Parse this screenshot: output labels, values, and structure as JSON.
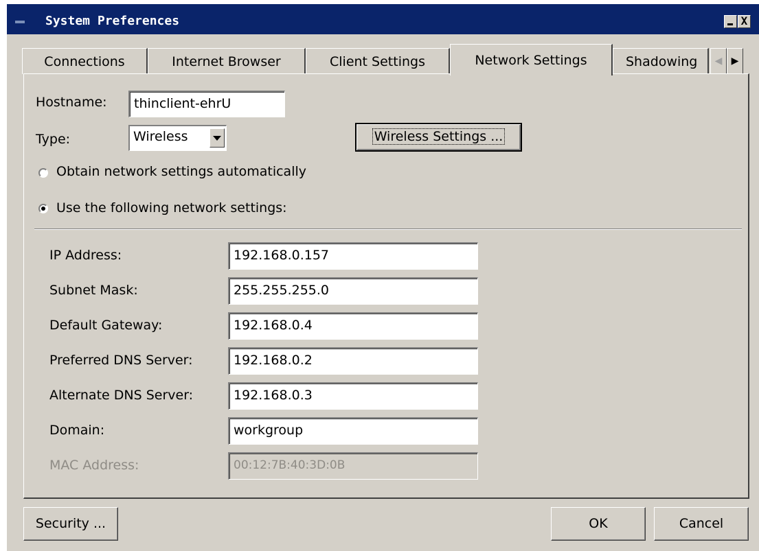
{
  "window": {
    "title": "System Preferences",
    "minimize_icon": "minimize-icon",
    "close_label": "X"
  },
  "tabs": [
    {
      "label": "Connections",
      "active": false
    },
    {
      "label": "Internet Browser",
      "active": false
    },
    {
      "label": "Client Settings",
      "active": false
    },
    {
      "label": "Network Settings",
      "active": true
    },
    {
      "label": "Shadowing",
      "active": false
    }
  ],
  "tab_scroll": {
    "left_icon": "chevron-left-icon",
    "right_icon": "chevron-right-icon"
  },
  "network": {
    "hostname_label": "Hostname:",
    "hostname_value": "thinclient-ehrU",
    "type_label": "Type:",
    "type_value": "Wireless",
    "wireless_button": "Wireless Settings ...",
    "auto_radio_label": "Obtain network settings automatically",
    "manual_radio_label": "Use the following network settings:",
    "selected_mode": "manual",
    "fields": [
      {
        "label": "IP Address:",
        "value": "192.168.0.157",
        "enabled": true
      },
      {
        "label": "Subnet Mask:",
        "value": "255.255.255.0",
        "enabled": true
      },
      {
        "label": "Default Gateway:",
        "value": "192.168.0.4",
        "enabled": true
      },
      {
        "label": "Preferred DNS Server:",
        "value": "192.168.0.2",
        "enabled": true
      },
      {
        "label": "Alternate DNS Server:",
        "value": "192.168.0.3",
        "enabled": true
      },
      {
        "label": "Domain:",
        "value": "workgroup",
        "enabled": true
      },
      {
        "label": "MAC Address:",
        "value": "00:12:7B:40:3D:0B",
        "enabled": false
      }
    ]
  },
  "footer": {
    "security_button": "Security ...",
    "ok_button": "OK",
    "cancel_button": "Cancel"
  },
  "colors": {
    "titlebar": "#0a246a",
    "face": "#d4d0c8",
    "disabled_text": "#8f8c86"
  }
}
